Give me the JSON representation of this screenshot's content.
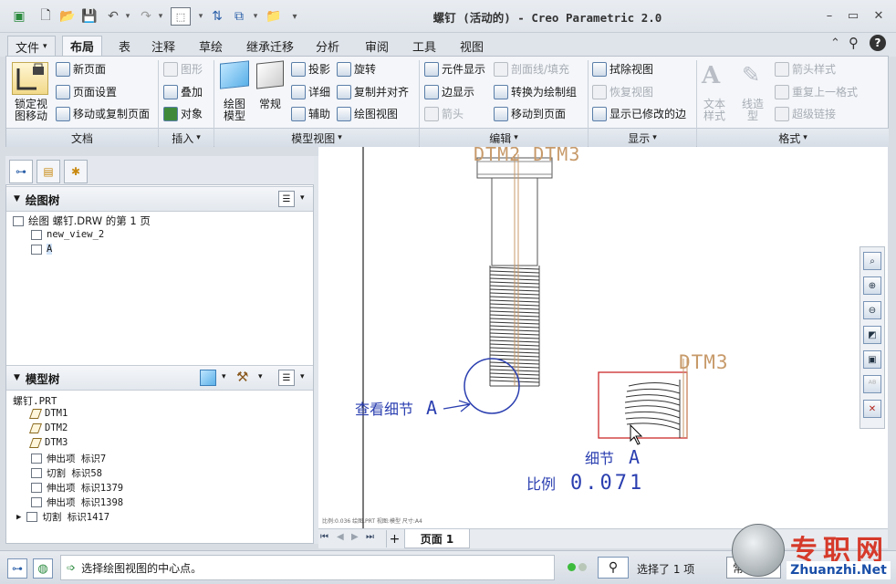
{
  "window": {
    "title": "螺钉 (活动的) - Creo Parametric 2.0",
    "controls": [
      "–",
      "▭",
      "✕"
    ]
  },
  "quick_access": [
    "new-icon",
    "open-icon",
    "save-icon",
    "undo-icon",
    "redo-icon",
    "select-box-icon",
    "regenerate-icon",
    "windows-icon",
    "close-window-icon"
  ],
  "tabs": {
    "file": "文件",
    "items": [
      "布局",
      "表",
      "注释",
      "草绘",
      "继承迁移",
      "分析",
      "审阅",
      "工具",
      "视图"
    ],
    "active": "布局"
  },
  "ribbon": {
    "doc": {
      "lock_label": "锁定视\n图移动",
      "new_page": "新页面",
      "page_setup": "页面设置",
      "move_copy": "移动或复制页面",
      "group": "文档"
    },
    "insert": {
      "graphic": "图形",
      "overlay": "叠加",
      "object": "对象",
      "group": "插入"
    },
    "model_views": {
      "drawing_model": "绘图\n模型",
      "general": "常规",
      "projection": "投影",
      "detailed": "详细",
      "auxiliary": "辅助",
      "revolve": "旋转",
      "copy_align": "复制并对齐",
      "drawing_view": "绘图视图",
      "group": "模型视图"
    },
    "edit": {
      "component_display": "元件显示",
      "section_line": "剖面线/填充",
      "edge_display": "边显示",
      "convert_draw": "转换为绘制组",
      "arrow": "箭头",
      "move_to_page": "移动到页面",
      "group": "编辑"
    },
    "display": {
      "erase_view": "拭除视图",
      "resume_view": "恢复视图",
      "show_modified": "显示已修改的边",
      "group": "显示"
    },
    "format": {
      "text_style": "文本\n样式",
      "line_style": "线造\n型",
      "arrow_style": "箭头样式",
      "repeat_format": "重复上一格式",
      "hyperlink": "超级链接",
      "group": "格式"
    }
  },
  "drawing_tree": {
    "header": "绘图树",
    "root": "绘图 螺钉.DRW 的第 1 页",
    "items": [
      "new_view_2",
      "A"
    ]
  },
  "model_tree": {
    "header": "模型树",
    "root": "螺钉.PRT",
    "items": [
      {
        "label": "DTM1",
        "icon": "datum-plane-icon"
      },
      {
        "label": "DTM2",
        "icon": "datum-plane-icon"
      },
      {
        "label": "DTM3",
        "icon": "datum-plane-icon"
      },
      {
        "label": "伸出项 标识7",
        "icon": "extrude-icon"
      },
      {
        "label": "切割 标识58",
        "icon": "cut-icon"
      },
      {
        "label": "伸出项 标识1379",
        "icon": "extrude-icon"
      },
      {
        "label": "伸出项 标识1398",
        "icon": "extrude-icon"
      },
      {
        "label": "切割 标识1417",
        "icon": "cut-icon"
      }
    ]
  },
  "drawing": {
    "top_label": "DTM2 DTM3",
    "view_detail_label": "查看细节",
    "detail_letter": "A",
    "dtm3_label": "DTM3",
    "detail_caption": "细节",
    "detail_caption_letter": "A",
    "scale_label": "比例",
    "scale_value": "0.071",
    "bottom_tiny": "比例:0.036   绘图.PRT   视图:模型   尺寸:A4"
  },
  "page_bar": {
    "nav": [
      "⏮",
      "◀",
      "▶",
      "⏭"
    ],
    "add": "+",
    "page_tab": "页面 1"
  },
  "status": {
    "message": "选择绘图视图的中心点。",
    "selected": "选择了 1 项",
    "filter": "常规"
  },
  "watermark": {
    "cn": "专职网",
    "url": "Zhuanzhi.Net"
  }
}
